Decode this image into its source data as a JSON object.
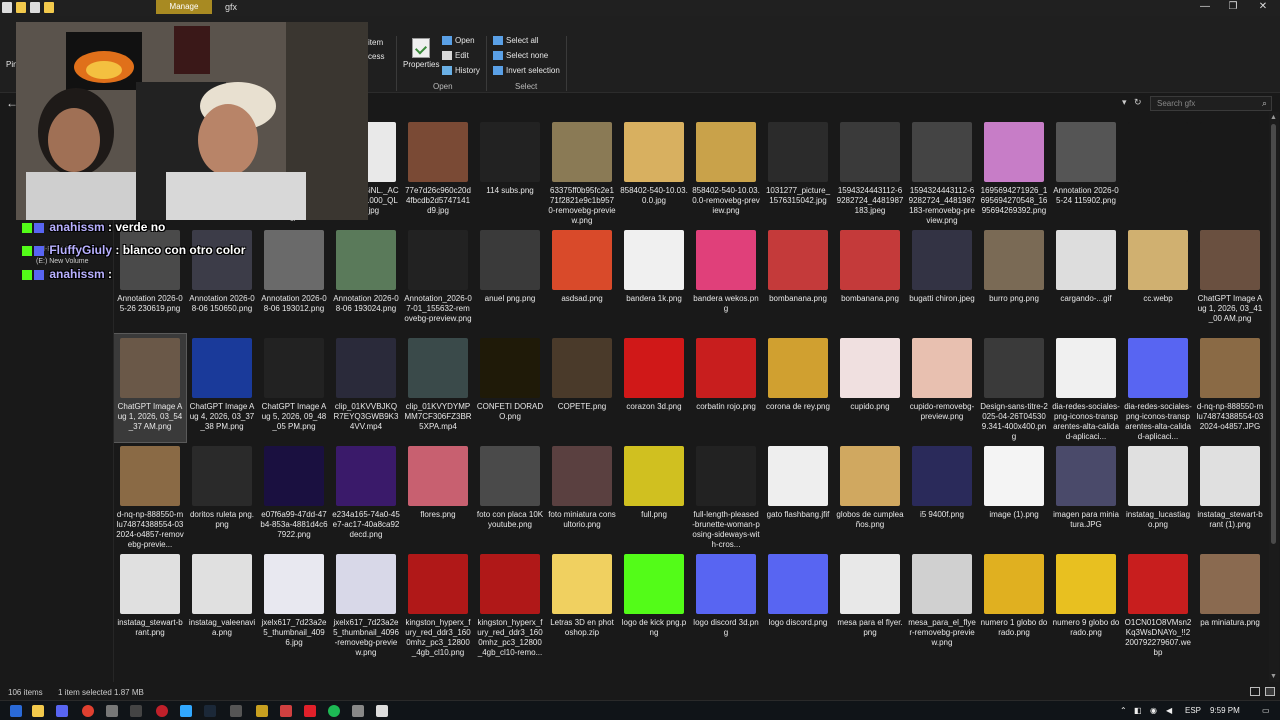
{
  "window": {
    "manage_tab": "Manage",
    "title": "gfx",
    "minimize": "—",
    "restore": "❐",
    "close": "✕"
  },
  "ribbon": {
    "open_label": "Open",
    "edit_label": "Edit",
    "history_label": "History",
    "properties_label": "Properties",
    "select_all": "Select all",
    "select_none": "Select none",
    "invert_selection": "Invert selection",
    "group_open": "Open",
    "group_select": "Select",
    "partial_item": "item",
    "partial_access": "ccess",
    "partial_pin": "Pin"
  },
  "address": {
    "refresh": "↻",
    "dropdown": "▾",
    "search_placeholder": "Search gfx",
    "search_icon": "search-icon"
  },
  "left_pane": {
    "partial_or": "or",
    "new_volume": "(E:) New Volume",
    "partial_drive": "Cd-ROM Drive"
  },
  "files": [
    {
      "name": "",
      "thumb": "#2a2a2a"
    },
    {
      "name": "0.jpg",
      "thumb": "#f4f4f4"
    },
    {
      "name": "1_1000-removebg-preview.png",
      "thumb": "#3daa3d"
    },
    {
      "name": "61OIN9rSiNL._AC_UF894,1000_QL80_.jpg",
      "thumb": "#e9e9e9"
    },
    {
      "name": "77e7d26c960c20d4fbcdb2d5747141d9.jpg",
      "thumb": "#7a4a35"
    },
    {
      "name": "114 subs.png",
      "thumb": "#222222"
    },
    {
      "name": "63375ff0b95fc2e171f2821e9c1b9570-removebg-preview.png",
      "thumb": "#8a7a55"
    },
    {
      "name": "858402-540-10.03.0.0.jpg",
      "thumb": "#d8b060"
    },
    {
      "name": "858402-540-10.03.0.0-removebg-preview.png",
      "thumb": "#c9a24a"
    },
    {
      "name": "1031277_picture_1576315042.jpg",
      "thumb": "#2b2b2b"
    },
    {
      "name": "1594324443112-69282724_4481987183.jpeg",
      "thumb": "#3a3a3a"
    },
    {
      "name": "1594324443112-69282724_4481987183-removebg-preview.png",
      "thumb": "#444444"
    },
    {
      "name": "1695694271926_1695694270548_1695694269392.png",
      "thumb": "#c77dc7"
    },
    {
      "name": "Annotation 2026-05-24 115902.png",
      "thumb": "#555555"
    },
    {
      "name": "",
      "thumb": "#191919"
    },
    {
      "name": "",
      "thumb": "#191919"
    },
    {
      "name": "Annotation 2026-05-26 230619.png",
      "thumb": "#4a4a4a"
    },
    {
      "name": "Annotation 2026-08-06 150650.png",
      "thumb": "#3c3c48"
    },
    {
      "name": "Annotation 2026-08-06 193012.png",
      "thumb": "#6a6a6a"
    },
    {
      "name": "Annotation 2026-08-06 193024.png",
      "thumb": "#5a7a5a"
    },
    {
      "name": "Annotation_2026-07-01_155632-removebg-preview.png",
      "thumb": "#222222"
    },
    {
      "name": "anuel png.png",
      "thumb": "#3a3a3a"
    },
    {
      "name": "asdsad.png",
      "thumb": "#d94a2a"
    },
    {
      "name": "bandera 1k.png",
      "thumb": "#f0f0f0"
    },
    {
      "name": "bandera wekos.png",
      "thumb": "#e0407a"
    },
    {
      "name": "bombanana.png",
      "thumb": "#c43a3a"
    },
    {
      "name": "bombanana.png",
      "thumb": "#c43a3a"
    },
    {
      "name": "bugatti chiron.jpeg",
      "thumb": "#333344"
    },
    {
      "name": "burro png.png",
      "thumb": "#7a6a55"
    },
    {
      "name": "cargando-...gif",
      "thumb": "#dddddd"
    },
    {
      "name": "cc.webp",
      "thumb": "#d0b070"
    },
    {
      "name": "ChatGPT Image Aug 1, 2026, 03_41_00 AM.png",
      "thumb": "#6a5040"
    },
    {
      "name": "ChatGPT Image Aug 1, 2026, 03_54_37 AM.png",
      "thumb": "#6a5848",
      "selected": true
    },
    {
      "name": "ChatGPT Image Aug 4, 2026, 03_37_38 PM.png",
      "thumb": "#1a3a9a"
    },
    {
      "name": "ChatGPT Image Aug 5, 2026, 09_48_05 PM.png",
      "thumb": "#222222"
    },
    {
      "name": "clip_01KVVBJKQR7EYQ3GWB9K34VV.mp4",
      "thumb": "#2a2a3a"
    },
    {
      "name": "clip_01KVYDYMPMM7CF306FZ3BR5XPA.mp4",
      "thumb": "#3a4a4a"
    },
    {
      "name": "CONFETI DORADO.png",
      "thumb": "#1f1a08"
    },
    {
      "name": "COPETE.png",
      "thumb": "#4a3a2a"
    },
    {
      "name": "corazon 3d.png",
      "thumb": "#d01818"
    },
    {
      "name": "corbatin rojo.png",
      "thumb": "#c81e1e"
    },
    {
      "name": "corona de rey.png",
      "thumb": "#d0a030"
    },
    {
      "name": "cupido.png",
      "thumb": "#f0e0e0"
    },
    {
      "name": "cupido-removebg-preview.png",
      "thumb": "#e8c0b0"
    },
    {
      "name": "Design-sans-titre-2025-04-26T045309.341-400x400.png",
      "thumb": "#3a3a3a"
    },
    {
      "name": "dia-redes-sociales-png-iconos-transparentes-alta-calidad-aplicaci...",
      "thumb": "#f0f0f0"
    },
    {
      "name": "dia-redes-sociales-png-iconos-transparentes-alta-calidad-aplicaci...",
      "thumb": "#5865f2"
    },
    {
      "name": "d-nq-np-888550-mlu74874388554-032024-o4857.JPG",
      "thumb": "#8a6a45"
    },
    {
      "name": "d-nq-np-888550-mlu74874388554-032024-o4857-removebg-previe...",
      "thumb": "#8a6a45"
    },
    {
      "name": "doritos ruleta png.png",
      "thumb": "#2a2a2a"
    },
    {
      "name": "e07f6a99-47dd-47b4-853a-4881d4c67922.png",
      "thumb": "#1a1040"
    },
    {
      "name": "e234a165-74a0-45e7-ac17-40a8ca92decd.png",
      "thumb": "#3a1a6a"
    },
    {
      "name": "flores.png",
      "thumb": "#c86070"
    },
    {
      "name": "foto con placa 10K youtube.png",
      "thumb": "#4a4a4a"
    },
    {
      "name": "foto miniatura consultorio.png",
      "thumb": "#5a4040"
    },
    {
      "name": "full.png",
      "thumb": "#d0c020"
    },
    {
      "name": "full-length-pleased-brunette-woman-posing-sideways-with-cros...",
      "thumb": "#222222"
    },
    {
      "name": "gato flashbang.jfif",
      "thumb": "#eeeeee"
    },
    {
      "name": "globos de cumpleaños.png",
      "thumb": "#d0a860"
    },
    {
      "name": "i5 9400f.png",
      "thumb": "#2a2a5a"
    },
    {
      "name": "image (1).png",
      "thumb": "#f4f4f4"
    },
    {
      "name": "imagen para miniatura.JPG",
      "thumb": "#4a4a6a"
    },
    {
      "name": "instatag_lucastiago.png",
      "thumb": "#e0e0e0"
    },
    {
      "name": "instatag_stewart-brant (1).png",
      "thumb": "#e0e0e0"
    },
    {
      "name": "instatag_stewart-brant.png",
      "thumb": "#e0e0e0"
    },
    {
      "name": "instatag_valeenavia.png",
      "thumb": "#e0e0e0"
    },
    {
      "name": "jxelx617_7d23a2e5_thumbnail_4096.jpg",
      "thumb": "#e8e8f0"
    },
    {
      "name": "jxelx617_7d23a2e5_thumbnail_4096-removebg-preview.png",
      "thumb": "#d8d8e8"
    },
    {
      "name": "kingston_hyperx_fury_red_ddr3_1600mhz_pc3_12800_4gb_cl10.png",
      "thumb": "#b01818"
    },
    {
      "name": "kingston_hyperx_fury_red_ddr3_1600mhz_pc3_12800_4gb_cl10-remo...",
      "thumb": "#b01818"
    },
    {
      "name": "Letras 3D en photoshop.zip",
      "thumb": "#f0d060"
    },
    {
      "name": "logo de kick png.png",
      "thumb": "#53fc18"
    },
    {
      "name": "logo discord 3d.png",
      "thumb": "#5865f2"
    },
    {
      "name": "logo discord.png",
      "thumb": "#5865f2"
    },
    {
      "name": "mesa para el flyer.png",
      "thumb": "#e8e8e8"
    },
    {
      "name": "mesa_para_el_flyer-removebg-preview.png",
      "thumb": "#d0d0d0"
    },
    {
      "name": "numero 1 globo dorado.png",
      "thumb": "#e0b020"
    },
    {
      "name": "numero 9 globo dorado.png",
      "thumb": "#e8c020"
    },
    {
      "name": "O1CN01O8VMsn2Kq3WsDNAYo_!!2200792279607.webp",
      "thumb": "#c81e1e"
    },
    {
      "name": "pa miniatura.png",
      "thumb": "#8a6a50"
    }
  ],
  "status": {
    "item_count": "106 items",
    "selected": "1 item selected  1.87 MB"
  },
  "tray": {
    "lang": "ESP",
    "time": "9:59 PM"
  },
  "chat": [
    {
      "user": "anahissm",
      "sep": " : ",
      "msg": "verde no"
    },
    {
      "user": "FluffyGiuly",
      "sep": " : ",
      "msg": "blanco con otro color"
    },
    {
      "user": "anahissm",
      "sep": " :",
      "msg": ""
    }
  ],
  "colors": {
    "manage_accent": "#a88a22",
    "selection": "#3a3a3a",
    "chat_user": "#b8b0ff"
  }
}
